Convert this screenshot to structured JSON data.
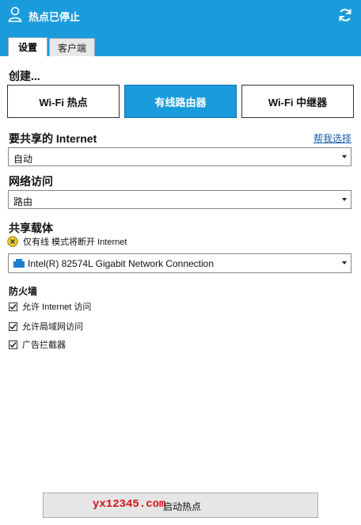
{
  "titlebar": {
    "title": "热点已停止"
  },
  "tabs": {
    "settings": "设置",
    "clients": "客户端"
  },
  "create": {
    "heading": "创建...",
    "modes": [
      {
        "label": "Wi-Fi 热点",
        "active": false
      },
      {
        "label": "有线路由器",
        "active": true
      },
      {
        "label": "Wi-Fi 中继器",
        "active": false
      }
    ]
  },
  "internet_share": {
    "heading": "要共享的 Internet",
    "help_link": "帮我选择",
    "value": "自动"
  },
  "network_access": {
    "heading": "网络访问",
    "value": "路由"
  },
  "share_medium": {
    "heading": "共享载体",
    "warning": "仅有线 模式将断开 Internet",
    "adapter": "Intel(R) 82574L Gigabit Network Connection"
  },
  "firewall": {
    "heading": "防火墙",
    "options": [
      {
        "label": "允许 Internet 访问",
        "checked": true
      },
      {
        "label": "允许局域网访问",
        "checked": true
      },
      {
        "label": "广告拦截器",
        "checked": true
      }
    ]
  },
  "footer": {
    "watermark": "yx12345.com",
    "start_label": "启动热点"
  },
  "colors": {
    "accent": "#1a9bdc"
  }
}
